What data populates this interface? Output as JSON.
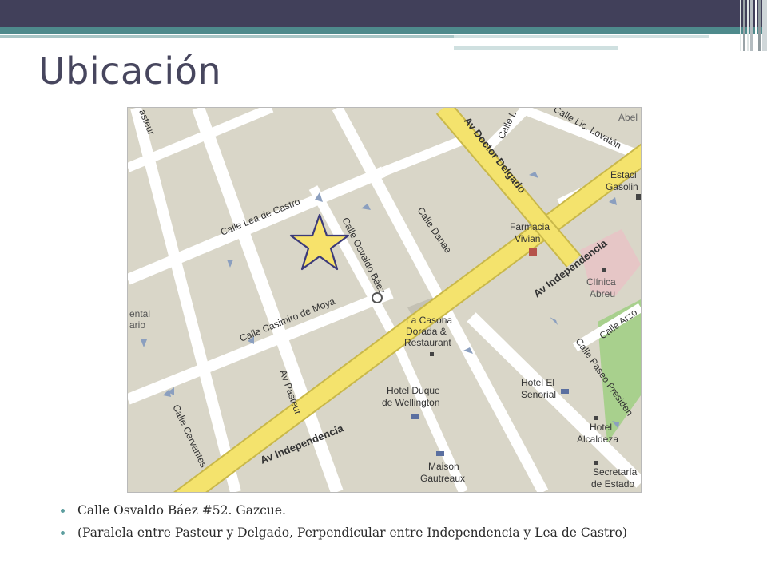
{
  "slide": {
    "title": "Ubicación",
    "bullets": [
      "Calle Osvaldo Báez #52. Gazcue.",
      "(Paralela entre Pasteur y Delgado, Perpendicular entre Independencia y Lea de Castro)"
    ]
  },
  "map": {
    "streets": {
      "lea_de_castro": "Calle Lea de Castro",
      "osvaldo_baez": "Calle Osvaldo Báez",
      "casimiro_de_moya": "Calle Casimiro de Moya",
      "danae": "Calle Danae",
      "doctor_delgado": "Av Doctor Delgado",
      "independencia_upper": "Av Independencia",
      "independencia_lower": "Av Independencia",
      "pasteur": "Av Pasteur",
      "cervantes": "Calle Cervantes",
      "paseo_presidentes": "Calle Paseo Presiden",
      "lic_lovaton": "Calle Lic. Lovatón",
      "arzobispo": "Calle Arzo",
      "pasteur_top": "asteur",
      "calle_l": "Calle L"
    },
    "places": {
      "farmacia": [
        "Farmacia",
        "Vivian"
      ],
      "clinica": [
        "Clínica",
        "Abreu"
      ],
      "casona": [
        "La Casona",
        "Dorada &",
        "Restaurant"
      ],
      "hotel_duque": [
        "Hotel Duque",
        "de Wellington"
      ],
      "hotel_senorial": [
        "Hotel El",
        "Senorial"
      ],
      "hotel_alcaldeza": [
        "Hotel",
        "Alcaldeza"
      ],
      "maison": [
        "Maison",
        "Gautreaux"
      ],
      "secretaria": [
        "Secretaría",
        "de Estado"
      ],
      "estacion": [
        "Estaci",
        "Gasolin"
      ],
      "abel": "Abel",
      "ental": [
        "ental",
        "ario"
      ]
    },
    "colors": {
      "block": "#d9d6c8",
      "street": "#ffffff",
      "avenue": "#f4e36d",
      "avenue_edge": "#c9b84a",
      "park": "#a8d08d",
      "clinic": "#e6c6c6",
      "marker": "#f7e26b"
    }
  }
}
